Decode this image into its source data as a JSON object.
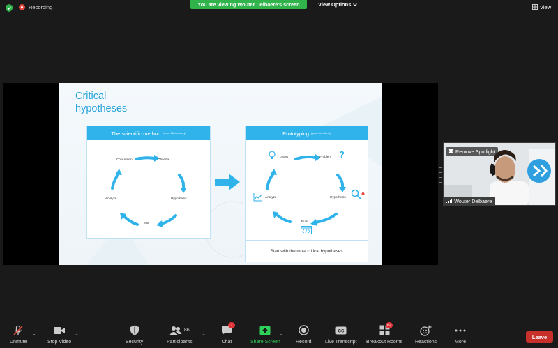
{
  "topbar": {
    "recording_label": "Recording",
    "viewing_banner": "You are viewing Wouter Delbaere's screen",
    "view_options_label": "View Options",
    "view_label": "View"
  },
  "slide": {
    "title_line1": "Critical",
    "title_line2": "hypotheses",
    "left_card": {
      "title": "The scientific method",
      "title_note": "(since 16th century)",
      "steps": [
        "Observe",
        "Hypothesis",
        "Test",
        "Analyze",
        "Conclusion"
      ]
    },
    "right_card": {
      "title": "Prototyping",
      "title_note": "(quick iterations)",
      "steps": [
        "Learn",
        "Problem",
        "Hypothesis",
        "Build",
        "Analyze"
      ],
      "footer": "Start with the most critical hypotheses"
    }
  },
  "participant": {
    "spotlight_label": "Remove Spotlight",
    "name": "Wouter Delbaere"
  },
  "toolbar": {
    "unmute": "Unmute",
    "stop_video": "Stop Video",
    "security": "Security",
    "participants": "Participants",
    "participants_count": "86",
    "chat": "Chat",
    "chat_badge": "1",
    "share_screen": "Share Screen",
    "record": "Record",
    "live_transcript": "Live Transcript",
    "breakout_rooms": "Breakout Rooms",
    "breakout_badge": "82",
    "reactions": "Reactions",
    "more": "More",
    "leave": "Leave"
  },
  "colors": {
    "accent_green": "#2fb34a",
    "slide_blue": "#2fb3ea",
    "leave_red": "#c8302c",
    "badge_red": "#e0343b"
  }
}
